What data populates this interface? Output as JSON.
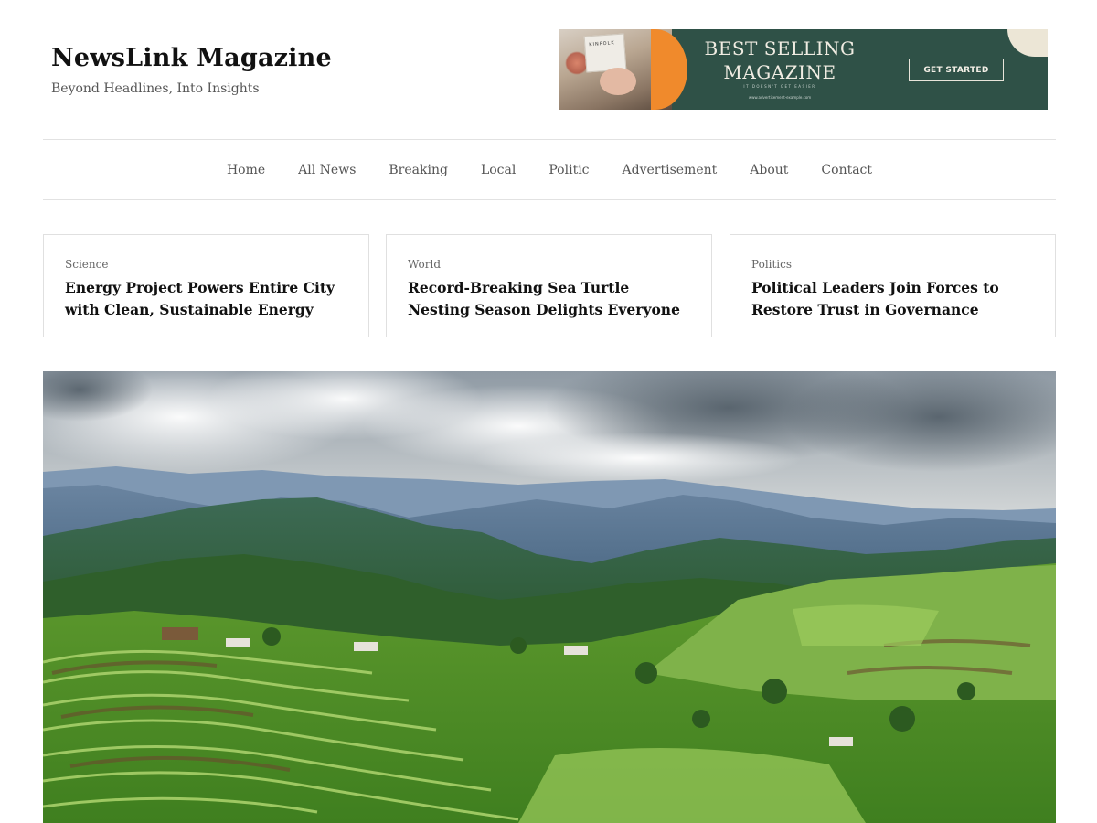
{
  "site": {
    "title": "NewsLink Magazine",
    "tagline": "Beyond Headlines, Into Insights"
  },
  "ad": {
    "photo_label": "KINFOLK",
    "headline_line1": "BEST SELLING",
    "headline_line2": "MAGAZINE",
    "subline": "IT DOESN'T GET EASIER",
    "url": "www.advertisement-example.com",
    "cta": "GET STARTED",
    "colors": {
      "background": "#2f5147",
      "accent": "#f08a2c",
      "corner": "#ece6d6"
    }
  },
  "nav": {
    "items": [
      {
        "label": "Home"
      },
      {
        "label": "All News"
      },
      {
        "label": "Breaking"
      },
      {
        "label": "Local"
      },
      {
        "label": "Politic"
      },
      {
        "label": "Advertisement"
      },
      {
        "label": "About"
      },
      {
        "label": "Contact"
      }
    ]
  },
  "featured": [
    {
      "category": "Science",
      "title": "Energy Project Powers Entire City with Clean, Sustainable Energy"
    },
    {
      "category": "World",
      "title": "Record-Breaking Sea Turtle Nesting Season Delights Everyone"
    },
    {
      "category": "Politics",
      "title": "Political Leaders Join Forces to Restore Trust in Governance"
    }
  ],
  "hero": {
    "image": "mountain-rice-terraces-landscape"
  }
}
